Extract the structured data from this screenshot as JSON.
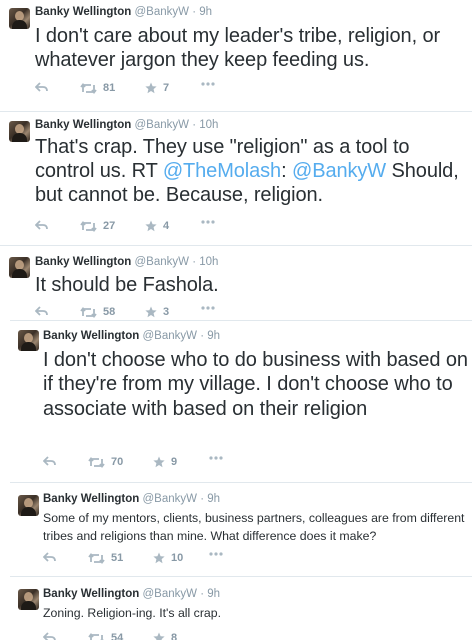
{
  "author": {
    "name": "Banky Wellington",
    "handle": "@BankyW",
    "separator": "·"
  },
  "tweets": [
    {
      "time": "9h",
      "text_parts": [
        "I don't care about my leader's tribe, religion, or whatever jargon they keep feeding us."
      ],
      "retweets": "81",
      "favorites": "7"
    },
    {
      "time": "10h",
      "text_parts": [
        "That's crap. They use \"religion\" as a tool to control us. RT ",
        "@TheMolash",
        ": ",
        "@BankyW",
        " Should, but cannot be. Because, religion."
      ],
      "retweets": "27",
      "favorites": "4"
    },
    {
      "time": "10h",
      "text_parts": [
        "It should be Fashola."
      ],
      "retweets": "58",
      "favorites": "3"
    },
    {
      "time": "9h",
      "text_parts": [
        "I don't choose who to do business with based on if they're from my village. I don't choose who to associate with based on their religion"
      ],
      "retweets": "70",
      "favorites": "9"
    },
    {
      "time": "9h",
      "text_parts": [
        "Some of my mentors, clients, business partners, colleagues are from different tribes and religions than mine. What difference does it make?"
      ],
      "retweets": "51",
      "favorites": "10"
    },
    {
      "time": "9h",
      "text_parts": [
        "Zoning. Religion-ing. It's all crap."
      ],
      "retweets": "54",
      "favorites": "8"
    }
  ],
  "icons": {
    "reply": "reply-icon",
    "retweet": "retweet-icon",
    "favorite": "star-icon",
    "more": "more-icon"
  },
  "colors": {
    "text": "#292f33",
    "muted": "#8899a6",
    "link": "#55acee",
    "divider": "#e1e8ed"
  }
}
